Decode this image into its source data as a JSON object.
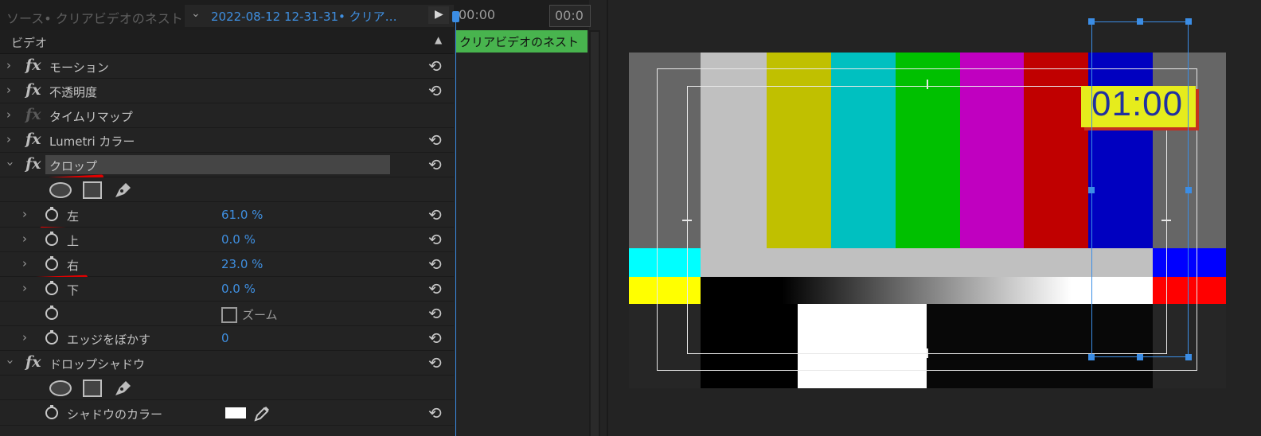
{
  "header": {
    "source_label": "ソース• クリアビデオのネスト",
    "clip_label": "2022-08-12  12-31-31• クリア…",
    "chevron_icon": "chevron-down-icon",
    "play_icon": "play-icon"
  },
  "section": {
    "label": "ビデオ",
    "collapse_icon": "collapse-up-icon"
  },
  "effects": [
    {
      "name": "モーション",
      "enabled": true
    },
    {
      "name": "不透明度",
      "enabled": true
    },
    {
      "name": "タイムリマップ",
      "enabled": false
    },
    {
      "name": "Lumetri カラー",
      "enabled": true
    },
    {
      "name": "クロップ",
      "enabled": true,
      "expanded": true
    },
    {
      "name": "ドロップシャドウ",
      "enabled": true,
      "expanded": true
    }
  ],
  "crop_params": [
    {
      "name": "左",
      "value": "61.0 %"
    },
    {
      "name": "上",
      "value": "0.0 %"
    },
    {
      "name": "右",
      "value": "23.0 %"
    },
    {
      "name": "下",
      "value": "0.0 %"
    },
    {
      "name": "",
      "checkbox_label": "ズーム",
      "checked": false
    },
    {
      "name": "エッジをぼかす",
      "value": "0"
    }
  ],
  "shadow_params": [
    {
      "name": "シャドウのカラー",
      "color": "#ffffff"
    }
  ],
  "timeline": {
    "timecode_start": "00:00",
    "timecode_end": "00:0",
    "clip_label": "クリアビデオのネスト",
    "clip_color": "#48b44e"
  },
  "monitor": {
    "timer_text": "01:00",
    "accent_color": "#3b8de5"
  }
}
